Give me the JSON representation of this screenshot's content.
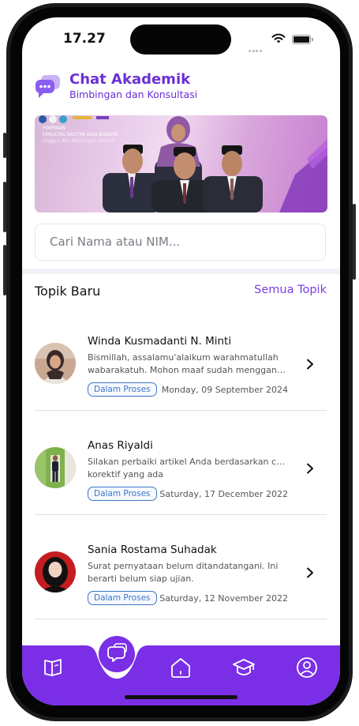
{
  "status_bar": {
    "time": "17.27"
  },
  "header": {
    "title": "Chat Akademik",
    "subtitle": "Bimbingan dan Konsultasi"
  },
  "banner": {
    "line1": "PIMPINAN",
    "line2": "FAKULTAS SASTRA DAN BUDAYA",
    "line3": "Unggul dan Berbangsa Santun"
  },
  "search": {
    "placeholder": "Cari Nama atau NIM..."
  },
  "section": {
    "title": "Topik Baru",
    "link": "Semua Topik"
  },
  "topics": [
    {
      "name": "Winda Kusmadanti N. Minti",
      "message_line1": "Bismillah, assalamu'alaikum warahmatullah",
      "message_line2": "wabarakatuh. Mohon maaf sudah mengganggu waktunya",
      "status": "Dalam Proses",
      "date": "Monday, 09 September 2024"
    },
    {
      "name": "Anas Riyaldi",
      "message_line1": "Silakan perbaiki artikel Anda berdasarkan catatan",
      "message_line2": "korektif yang ada",
      "status": "Dalam Proses",
      "date": "Saturday, 17 December 2022"
    },
    {
      "name": "Sania Rostama Suhadak",
      "message_line1": "Surat pernyataan belum ditandatangani. Ini",
      "message_line2": "berarti belum siap ujian.",
      "status": "Dalam Proses",
      "date": "Saturday, 12 November 2022"
    }
  ],
  "bottom_nav": {
    "items": [
      "book-icon",
      "chat-icon",
      "home-icon",
      "graduation-cap-icon",
      "user-circle-icon"
    ],
    "active": "chat-icon"
  },
  "colors": {
    "accent": "#7a2fe6",
    "badge": "#3b76c8",
    "title": "#6b2fd6"
  }
}
